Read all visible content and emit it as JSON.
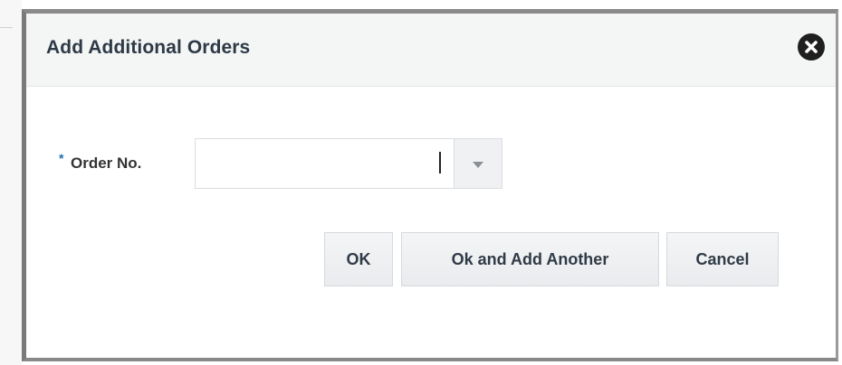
{
  "dialog": {
    "title": "Add Additional Orders"
  },
  "form": {
    "order_no": {
      "required_marker": "*",
      "label": "Order No.",
      "value": "",
      "placeholder": ""
    }
  },
  "buttons": {
    "ok_label": "OK",
    "ok_add_another_label": "Ok and Add Another",
    "cancel_label": "Cancel"
  },
  "icons": {
    "close": "close-circle-icon",
    "dropdown": "chevron-down-icon"
  },
  "colors": {
    "header_bg": "#f4f5f5",
    "title_text": "#2d3a46",
    "required_star": "#1f6fb5",
    "button_bg": "#e9ebee"
  }
}
